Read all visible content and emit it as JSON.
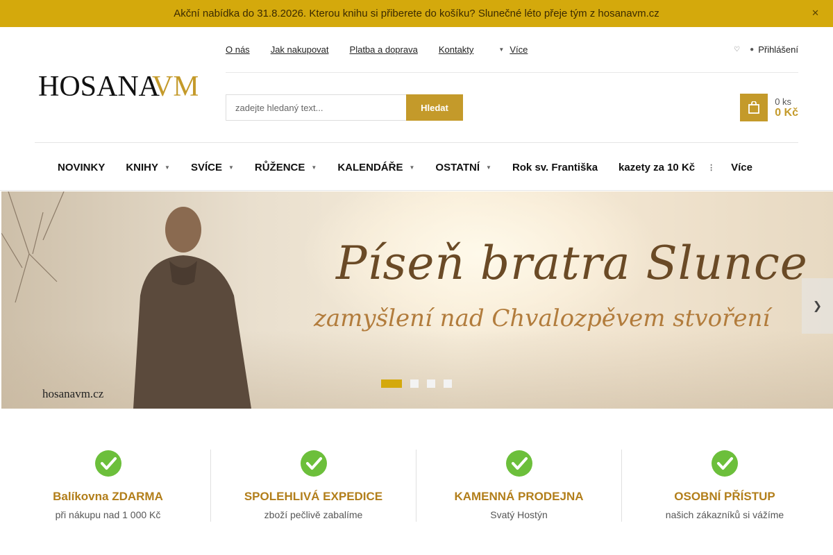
{
  "promo": {
    "text": "Akční nabídka do 31.8.2026. Kterou knihu si přiberete do košíku? Slunečné léto přeje tým z hosanavm.cz",
    "close_icon": "close-icon"
  },
  "header": {
    "logo_text_main": "HOSANA",
    "logo_text_accent": "VM",
    "nav": [
      "O nás",
      "Jak nakupovat",
      "Platba a doprava",
      "Kontakty"
    ],
    "nav_more": "Více",
    "login_label": "Přihlášení"
  },
  "search": {
    "placeholder": "zadejte hledaný text...",
    "button_label": "Hledat"
  },
  "cart": {
    "count": "0 ks",
    "price": "0 Kč"
  },
  "main_menu": {
    "items": [
      {
        "label": "NOVINKY",
        "has_dropdown": false
      },
      {
        "label": "KNIHY",
        "has_dropdown": true
      },
      {
        "label": "SVÍCE",
        "has_dropdown": true
      },
      {
        "label": "RŮŽENCE",
        "has_dropdown": true
      },
      {
        "label": "KALENDÁŘE",
        "has_dropdown": true
      },
      {
        "label": "OSTATNÍ",
        "has_dropdown": true
      },
      {
        "label": "Rok sv. Františka",
        "has_dropdown": false
      },
      {
        "label": "kazety za 10 Kč",
        "has_dropdown": false
      }
    ],
    "more_label": "Více"
  },
  "banner": {
    "title": "Píseň bratra Slunce",
    "subtitle": "zamyšlení nad Chvalozpěvem stvoření",
    "site": "hosanavm.cz",
    "slides": 4,
    "active_slide": 1
  },
  "usps": [
    {
      "title": "Balíkovna ZDARMA",
      "subtitle": "při nákupu nad 1 000 Kč"
    },
    {
      "title": "SPOLEHLIVÁ EXPEDICE",
      "subtitle": "zboží pečlivě zabalíme"
    },
    {
      "title": "KAMENNÁ PRODEJNA",
      "subtitle": "Svatý Hostýn"
    },
    {
      "title": "OSOBNÍ PŘÍSTUP",
      "subtitle": "našich zákazníků si vážíme"
    }
  ],
  "colors": {
    "promo_bg": "#d4a90c",
    "accent_gold": "#c49a2a",
    "usp_title": "#b27e1a",
    "check_green": "#6cbf3b"
  }
}
